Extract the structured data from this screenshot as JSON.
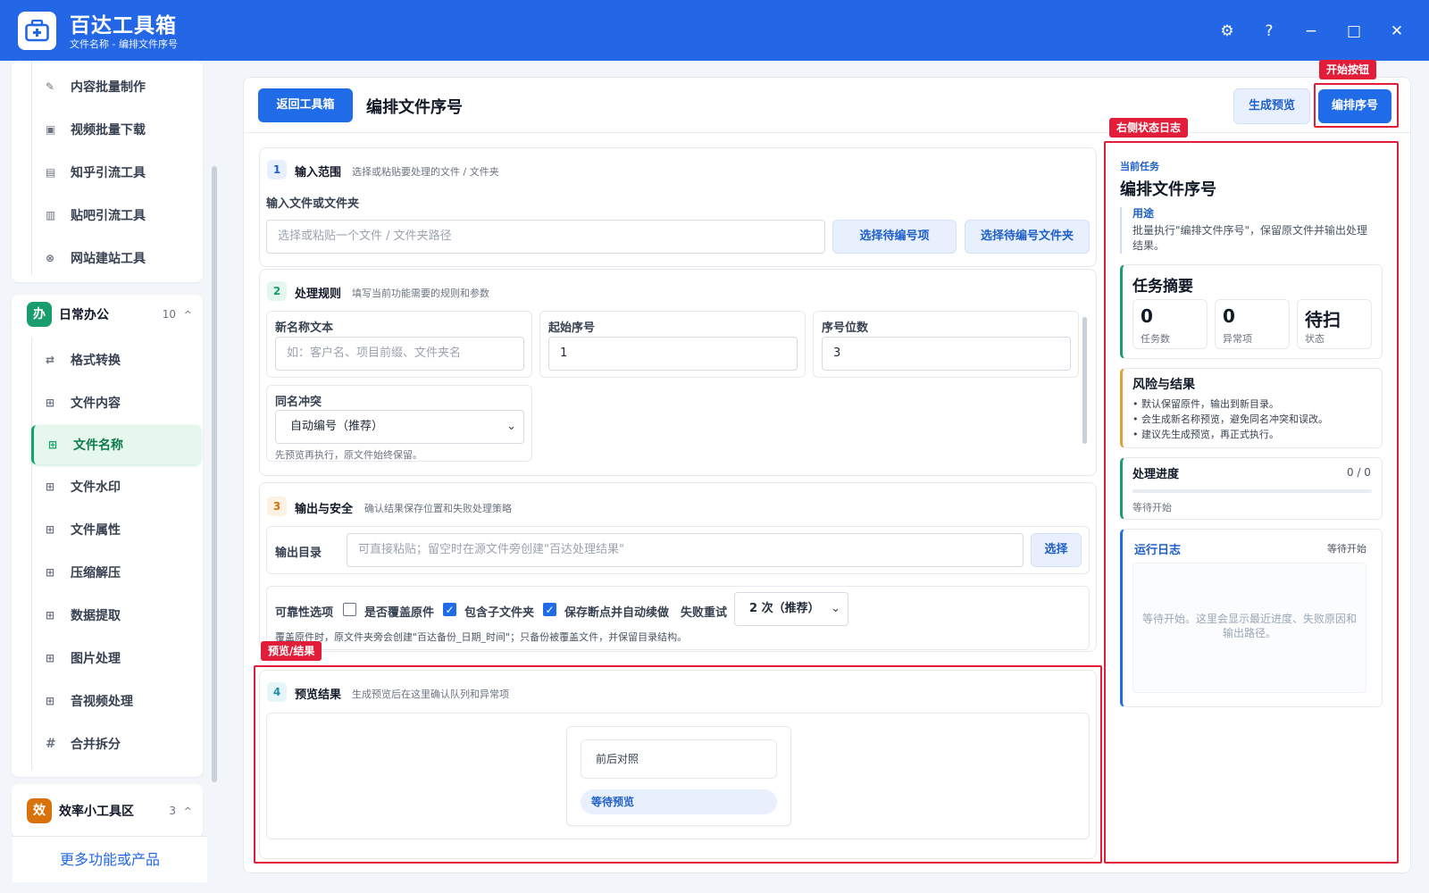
{
  "app": {
    "title": "百达工具箱",
    "subtitle": "文件名称 - 编排文件序号",
    "window_buttons": [
      "⚙",
      "?",
      "−",
      "□",
      "✕"
    ]
  },
  "sidebar": {
    "items_top": [
      {
        "icon": "pencil-icon",
        "label": "内容批量制作"
      },
      {
        "icon": "video-icon",
        "label": "视频批量下载"
      },
      {
        "icon": "zhihu-icon",
        "label": "知乎引流工具"
      },
      {
        "icon": "tieba-icon",
        "label": "贴吧引流工具"
      },
      {
        "icon": "globe-icon",
        "label": "网站建站工具"
      }
    ],
    "group_office": {
      "badge": "办",
      "badge_color": "#1a9d6c",
      "name": "日常办公",
      "count": "10",
      "items": [
        {
          "icon": "swap-icon",
          "label": "格式转换"
        },
        {
          "icon": "grid-icon",
          "label": "文件内容"
        },
        {
          "icon": "grid-icon",
          "label": "文件名称",
          "active": true
        },
        {
          "icon": "grid-icon",
          "label": "文件水印"
        },
        {
          "icon": "grid-icon",
          "label": "文件属性"
        },
        {
          "icon": "grid-icon",
          "label": "压缩解压"
        },
        {
          "icon": "grid-icon",
          "label": "数据提取"
        },
        {
          "icon": "grid-icon",
          "label": "图片处理"
        },
        {
          "icon": "grid-icon",
          "label": "音视频处理"
        },
        {
          "icon": "hash-icon",
          "label": "合并拆分"
        }
      ]
    },
    "group_efficiency": {
      "badge": "效",
      "badge_color": "#d8720c",
      "name": "效率小工具区",
      "count": "3"
    },
    "more_link": "更多功能或产品"
  },
  "header": {
    "back_button": "返回工具箱",
    "page_title": "编排文件序号",
    "preview_button": "生成预览",
    "start_button": "编排序号"
  },
  "section1": {
    "num": "1",
    "title": "输入范围",
    "desc": "选择或粘贴要处理的文件 / 文件夹",
    "field_label": "输入文件或文件夹",
    "input_placeholder": "选择或粘贴一个文件 / 文件夹路径",
    "btn_items": "选择待编号项",
    "btn_folder": "选择待编号文件夹"
  },
  "section2": {
    "num": "2",
    "title": "处理规则",
    "desc": "填写当前功能需要的规则和参数",
    "new_name_label": "新名称文本",
    "new_name_placeholder": "如：客户名、项目前缀、文件夹名",
    "start_label": "起始序号",
    "start_value": "1",
    "digits_label": "序号位数",
    "digits_value": "3",
    "conflict_label": "同名冲突",
    "conflict_value": "自动编号（推荐）",
    "hint": "先预览再执行，原文件始终保留。"
  },
  "section3": {
    "num": "3",
    "title": "输出与安全",
    "desc": "确认结果保存位置和失败处理策略",
    "output_label": "输出目录",
    "output_placeholder": "可直接粘贴；留空时在源文件旁创建\"百达处理结果\"",
    "choose_button": "选择",
    "reliability_label": "可靠性选项",
    "opt_overwrite": "是否覆盖原件",
    "opt_subfolders": "包含子文件夹",
    "opt_resume": "保存断点并自动续做",
    "retry_label": "失败重试",
    "retry_value": "2 次（推荐）",
    "note": "覆盖原件时，原文件夹旁会创建\"百达备份_日期_时间\"；只备份被覆盖文件，并保留目录结构。"
  },
  "section4": {
    "num": "4",
    "title": "预览结果",
    "desc": "生成预览后在这里确认队列和异常项",
    "compare_label": "前后对照",
    "waiting_badge": "等待预览"
  },
  "annotations": {
    "start_btn": "开始按钮",
    "right_log": "右侧状态日志",
    "preview_result": "预览/结果"
  },
  "right_panel": {
    "current_task_label": "当前任务",
    "task_name": "编排文件序号",
    "purpose_label": "用途",
    "purpose_text": "批量执行\"编排文件序号\"，保留原文件并输出处理结果。",
    "summary_title": "任务摘要",
    "stats": [
      {
        "value": "0",
        "label": "任务数"
      },
      {
        "value": "0",
        "label": "异常项"
      },
      {
        "value": "待扫",
        "label": "状态"
      }
    ],
    "risk_title": "风险与结果",
    "risks": [
      "默认保留原件，输出到新目录。",
      "会生成新名称预览，避免同名冲突和误改。",
      "建议先生成预览，再正式执行。"
    ],
    "progress_title": "处理进度",
    "progress_count": "0 / 0",
    "progress_status": "等待开始",
    "progress_fraction": 0,
    "log_title": "运行日志",
    "log_status": "等待开始",
    "log_placeholder": "等待开始。这里会显示最近进度、失败原因和输出路径。"
  }
}
